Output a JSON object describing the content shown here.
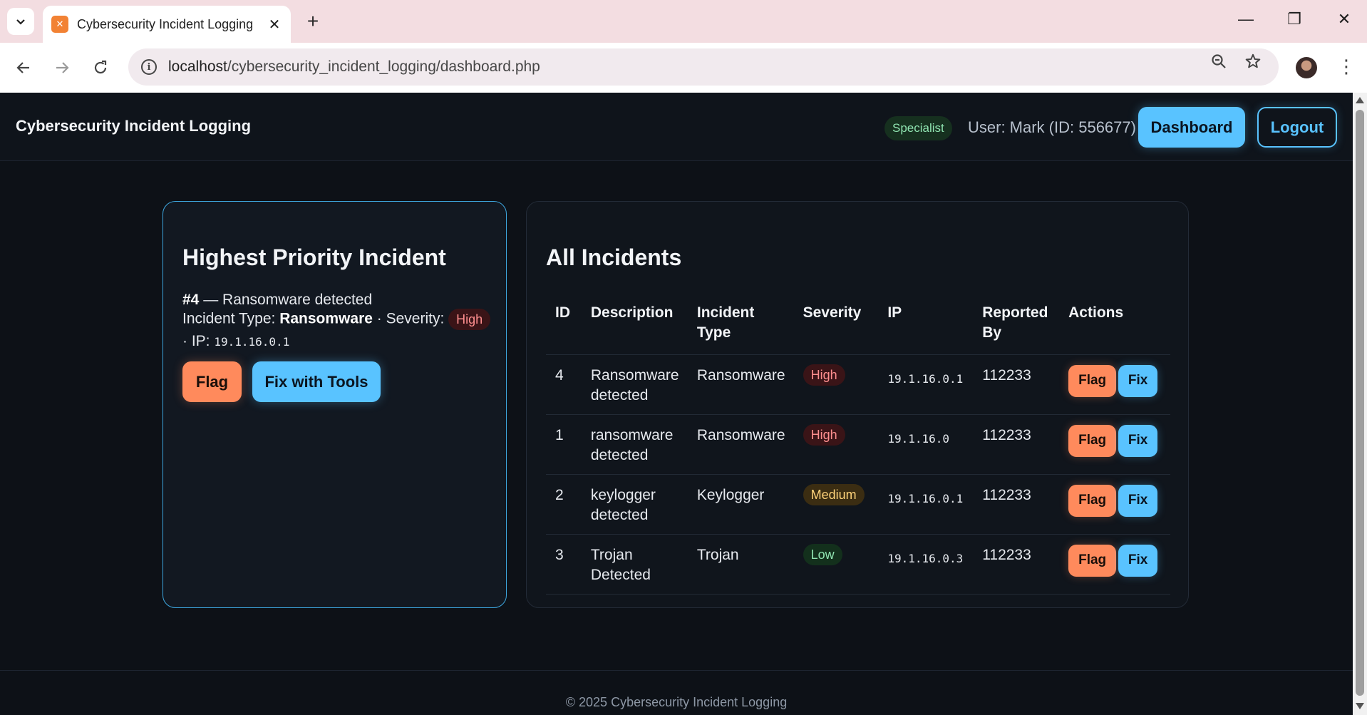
{
  "browser": {
    "tab_title": "Cybersecurity Incident Logging",
    "url_host": "localhost",
    "url_path": "/cybersecurity_incident_logging/dashboard.php"
  },
  "header": {
    "brand": "Cybersecurity Incident Logging",
    "role": "Specialist",
    "user": "User: Mark (ID: 556677)",
    "dashboard_label": "Dashboard",
    "logout_label": "Logout"
  },
  "priority": {
    "title": "Highest Priority Incident",
    "id_label": "#4",
    "description": "— Ransomware detected",
    "type_prefix": "Incident Type: ",
    "type": "Ransomware",
    "severity_prefix": "· Severity:",
    "severity": "High",
    "ip_prefix": "· IP:",
    "ip": "19.1.16.0.1",
    "flag_label": "Flag",
    "fix_label": "Fix with Tools"
  },
  "incidents": {
    "title": "All Incidents",
    "headers": {
      "id": "ID",
      "description": "Description",
      "type": "Incident Type",
      "severity": "Severity",
      "ip": "IP",
      "reported_by": "Reported By",
      "actions": "Actions"
    },
    "flag_label": "Flag",
    "fix_label": "Fix",
    "rows": [
      {
        "id": "4",
        "description": "Ransomware detected",
        "type": "Ransomware",
        "severity": "High",
        "ip": "19.1.16.0.1",
        "reported_by": "112233"
      },
      {
        "id": "1",
        "description": "ransomware detected",
        "type": "Ransomware",
        "severity": "High",
        "ip": "19.1.16.0",
        "reported_by": "112233"
      },
      {
        "id": "2",
        "description": "keylogger detected",
        "type": "Keylogger",
        "severity": "Medium",
        "ip": "19.1.16.0.1",
        "reported_by": "112233"
      },
      {
        "id": "3",
        "description": "Trojan Detected",
        "type": "Trojan",
        "severity": "Low",
        "ip": "19.1.16.0.3",
        "reported_by": "112233"
      }
    ]
  },
  "footer": {
    "text": "© 2025 Cybersecurity Incident Logging"
  },
  "colors": {
    "accent": "#59c3ff",
    "flag": "#ff8a5c",
    "background": "#0d1117"
  }
}
